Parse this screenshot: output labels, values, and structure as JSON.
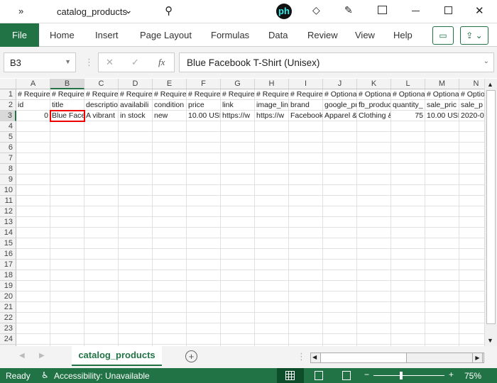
{
  "title_bar": {
    "overflow": "»",
    "file_name": "catalog_products",
    "chevron": "⌄"
  },
  "ribbon": {
    "tabs": [
      "File",
      "Home",
      "Insert",
      "Page Layout",
      "Formulas",
      "Data",
      "Review",
      "View",
      "Help"
    ]
  },
  "formula_bar": {
    "name_box": "B3",
    "cancel": "✕",
    "enter": "✓",
    "fx": "fx",
    "value": "Blue Facebook T-Shirt (Unisex)"
  },
  "grid": {
    "columns": [
      "A",
      "B",
      "C",
      "D",
      "E",
      "F",
      "G",
      "H",
      "I",
      "J",
      "K",
      "L",
      "M",
      "N"
    ],
    "selected_cell": "B3",
    "rows": [
      [
        "# Require",
        "# Require",
        "# Require",
        "# Require",
        "# Require",
        "# Require",
        "# Require",
        "# Require",
        "# Require",
        "# Optiona",
        "# Optiona",
        "# Optiona",
        "# Optiona",
        "# Optio"
      ],
      [
        "id",
        "title",
        "descriptio",
        "availabili",
        "condition",
        "price",
        "link",
        "image_lin",
        "brand",
        "google_pr",
        "fb_produc",
        "quantity_",
        "sale_pric",
        "sale_p"
      ],
      [
        "0",
        "Blue Face",
        "A vibrant",
        "in stock",
        "new",
        "10.00 USD",
        "https://w",
        "https://w",
        "Facebook",
        "Apparel &",
        "Clothing &",
        "75",
        "10.00 USD",
        "2020-0"
      ]
    ],
    "row_count": 25
  },
  "sheet_tabs": {
    "active": "catalog_products",
    "add": "+"
  },
  "status_bar": {
    "ready": "Ready",
    "accessibility": "Accessibility: Unavailable",
    "zoom": "75%",
    "minus": "−",
    "plus": "+"
  },
  "colors": {
    "accent": "#217346",
    "selection": "#e00000"
  }
}
